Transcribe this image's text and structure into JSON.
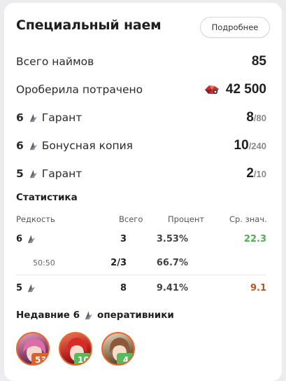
{
  "header": {
    "title": "Специальный наем",
    "more_label": "Подробнее"
  },
  "stats": {
    "total_label": "Всего наймов",
    "total_value": "85",
    "spent_label": "Ороберила потрачено",
    "spent_value": "42 500",
    "six_guarantee": {
      "stars": "6",
      "label": "Гарант",
      "value": "8",
      "max": "/80"
    },
    "six_bonus": {
      "stars": "6",
      "label": "Бонусная копия",
      "value": "10",
      "max": "/240"
    },
    "five_guarantee": {
      "stars": "5",
      "label": "Гарант",
      "value": "2",
      "max": "/10"
    }
  },
  "statistics": {
    "title": "Статистика",
    "columns": {
      "rarity": "Редкость",
      "total": "Всего",
      "percent": "Процент",
      "avg": "Ср. знач."
    },
    "rows": [
      {
        "rarity": "6",
        "total": "3",
        "percent": "3.53%",
        "avg": "22.3",
        "avg_color": "#4caf50"
      },
      {
        "rarity": "50:50",
        "total": "2/3",
        "percent": "66.7%",
        "avg": ""
      },
      {
        "rarity": "5",
        "total": "8",
        "percent": "9.41%",
        "avg": "9.1",
        "avg_color": "#c0541c"
      }
    ]
  },
  "recent": {
    "title_prefix": "Недавние 6",
    "title_suffix": "оперативники",
    "operators": [
      {
        "count": "53",
        "badge_color": "#d9632d"
      },
      {
        "count": "10",
        "badge_color": "#5cb85c"
      },
      {
        "count": "4",
        "badge_color": "#5cb85c"
      }
    ]
  },
  "colors": {
    "accent_orange": "#e9692c",
    "good_green": "#4caf50",
    "warn_orange": "#c0541c"
  }
}
